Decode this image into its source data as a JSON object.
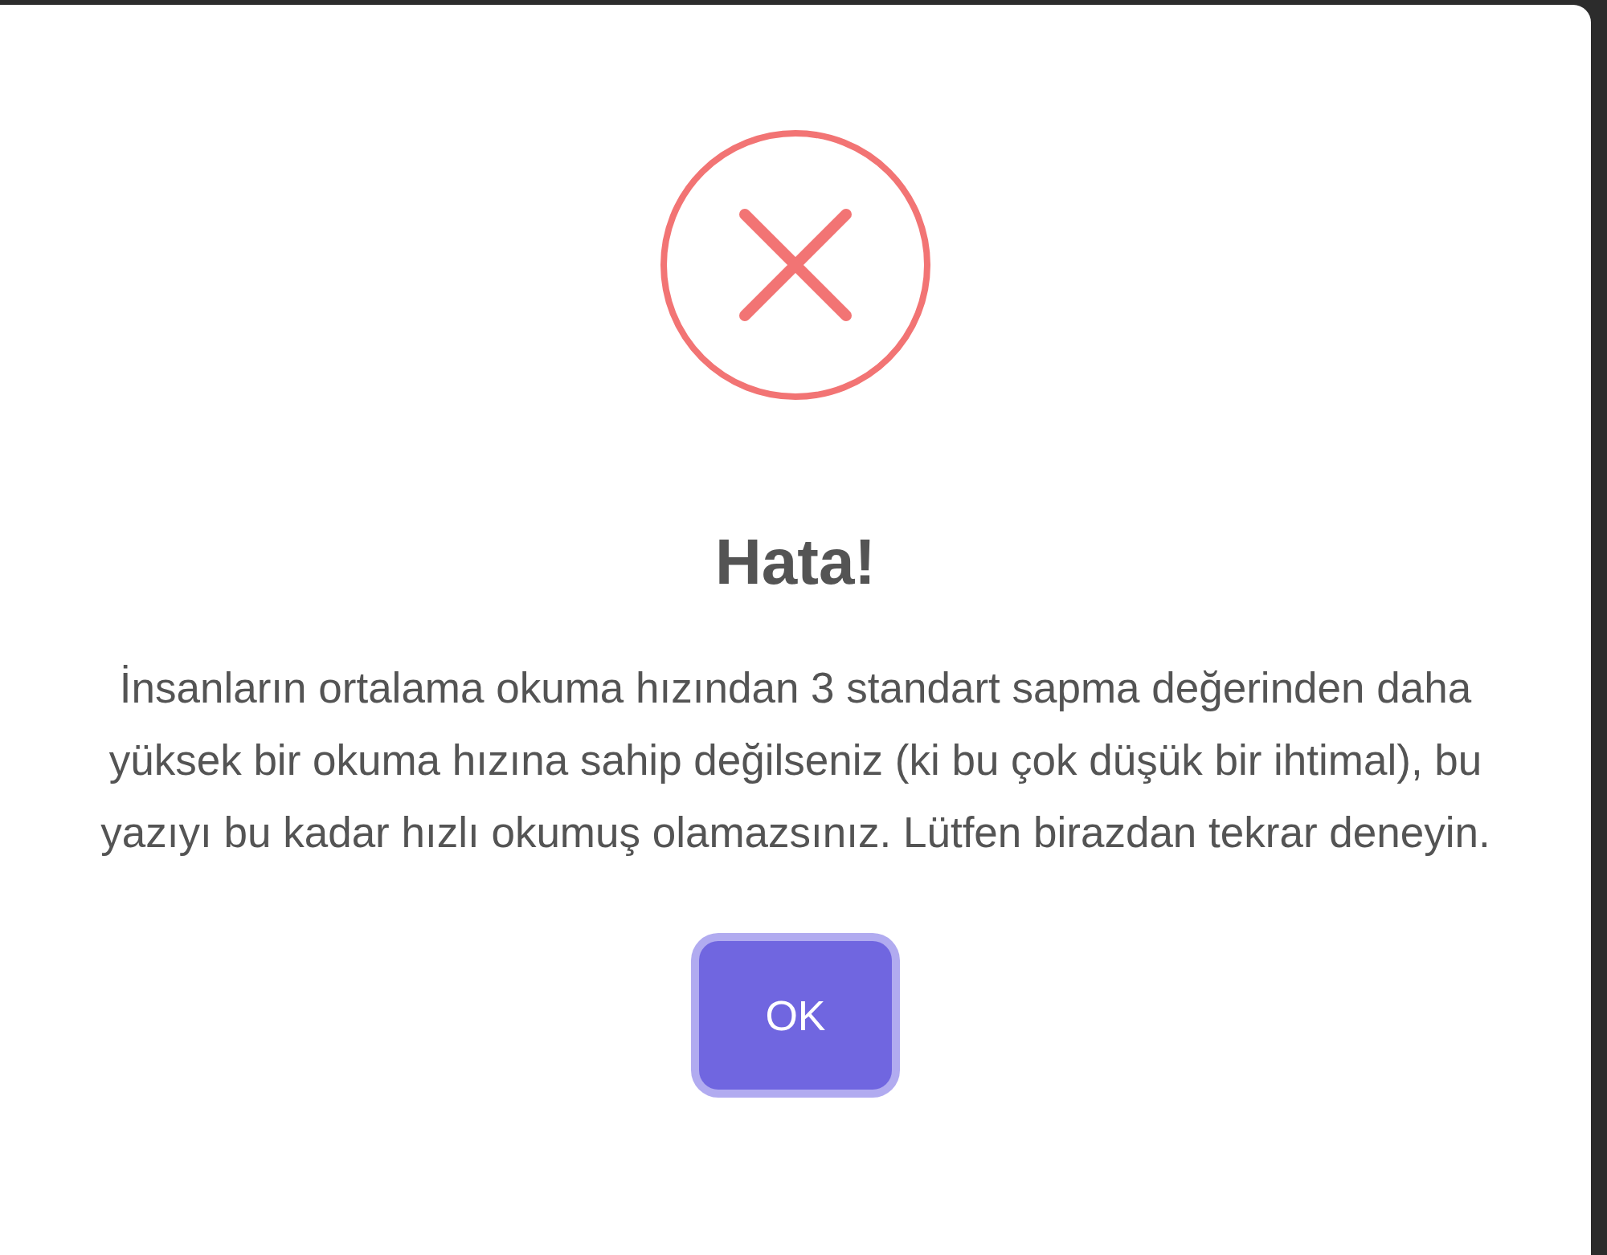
{
  "dialog": {
    "icon": {
      "kind": "error"
    },
    "title": "Hata!",
    "message": "İnsanların ortalama okuma hızından 3 standart sapma değerinden daha yüksek bir okuma hızına sahip değilseniz (ki bu çok düşük bir ihtimal), bu yazıyı bu kadar hızlı okumuş olamazsınız. Lütfen birazdan tekrar deneyin.",
    "buttons": [
      {
        "label": "OK",
        "focused": true
      }
    ]
  }
}
